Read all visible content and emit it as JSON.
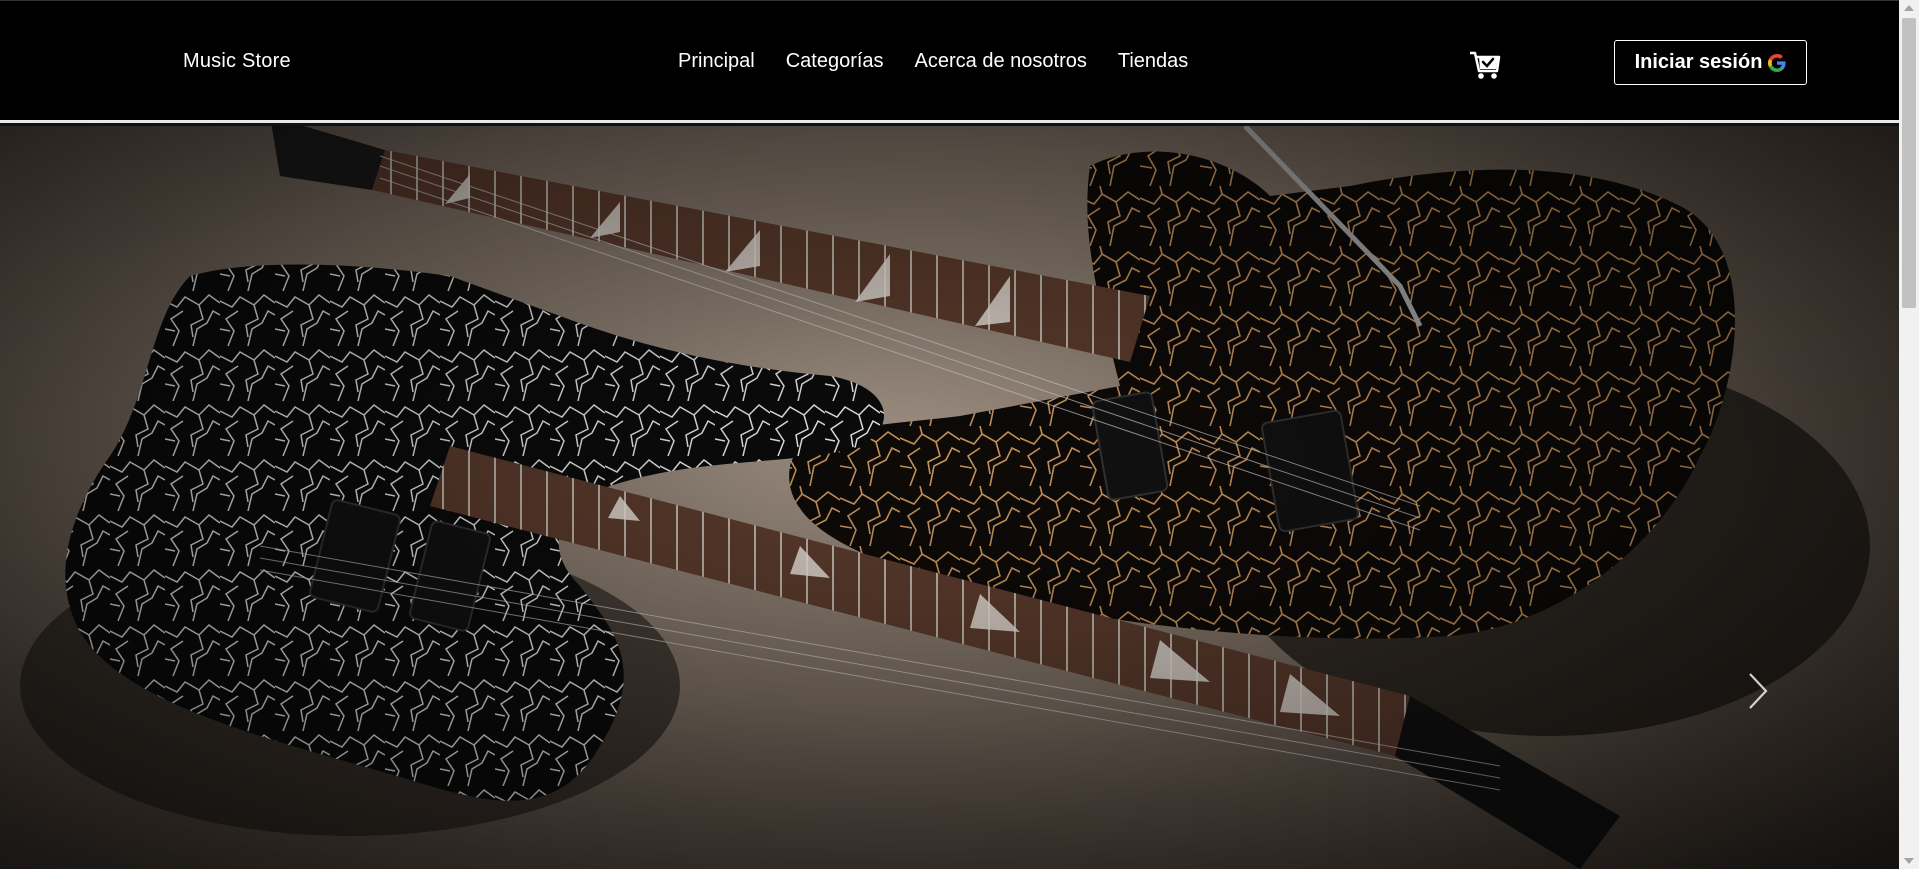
{
  "brand": "Music Store",
  "nav": {
    "items": [
      {
        "label": "Principal"
      },
      {
        "label": "Categorías"
      },
      {
        "label": "Acerca de nosotros"
      },
      {
        "label": "Tiendas"
      }
    ]
  },
  "cart_icon": "shopping-cart-check-icon",
  "login": {
    "label": "Iniciar sesión",
    "icon": "google-icon"
  },
  "hero": {
    "image_subject": "two crackle-finish electric guitars on concrete floor",
    "next_icon": "chevron-right-icon"
  },
  "colors": {
    "navbar_bg": "#000000",
    "text": "#ffffff",
    "guitar_gold": "#c8935a",
    "guitar_silver": "#e6e6e6"
  }
}
